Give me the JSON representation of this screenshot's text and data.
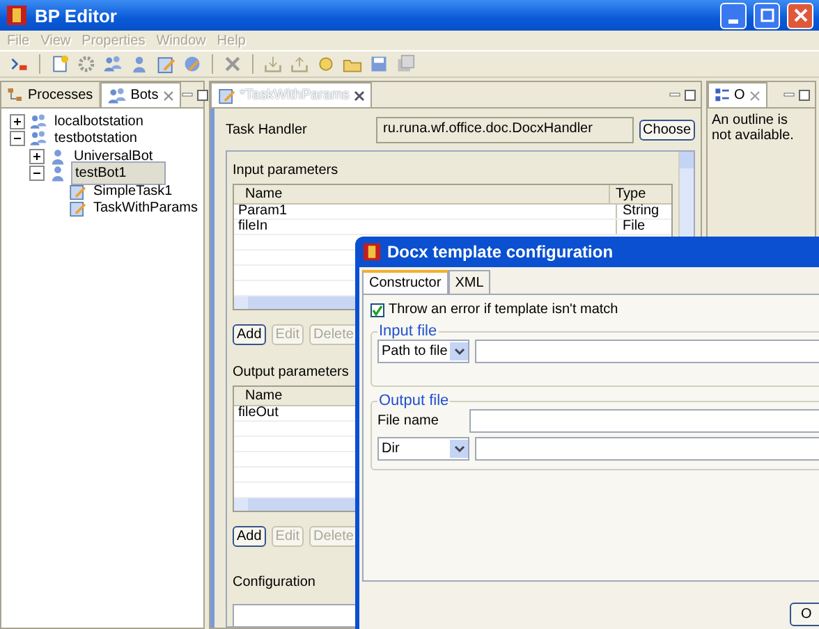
{
  "window": {
    "title": "BP Editor"
  },
  "menu": [
    {
      "label": "File",
      "disabled": true
    },
    {
      "label": "View",
      "disabled": true
    },
    {
      "label": "Properties",
      "disabled": true
    },
    {
      "label": "Window",
      "disabled": true
    },
    {
      "label": "Help",
      "disabled": true
    }
  ],
  "left_panel": {
    "tabs": [
      {
        "label": "Processes",
        "selected": false
      },
      {
        "label": "Bots",
        "selected": true
      }
    ],
    "tree": [
      {
        "label": "localbotstation",
        "kind": "station",
        "expanded": false,
        "selected": false
      },
      {
        "label": "testbotstation",
        "kind": "station",
        "expanded": true,
        "selected": false,
        "children": [
          {
            "label": "UniversalBot",
            "kind": "bot",
            "expanded": false,
            "selected": false
          },
          {
            "label": "testBot1",
            "kind": "bot",
            "expanded": true,
            "selected": true,
            "children": [
              {
                "label": "SimpleTask1",
                "kind": "task",
                "selected": false
              },
              {
                "label": "TaskWithParams",
                "kind": "task",
                "selected": false
              }
            ]
          }
        ]
      }
    ]
  },
  "editor": {
    "tab": "*TaskWithParams",
    "task_handler": {
      "label": "Task Handler",
      "value": "ru.runa.wf.office.doc.DocxHandler",
      "button": "Choose"
    },
    "input_parameters": {
      "title": "Input parameters",
      "columns": [
        "Name",
        "Type"
      ],
      "rows": [
        [
          "Param1",
          "String"
        ],
        [
          "fileIn",
          "File"
        ]
      ],
      "buttons": [
        {
          "label": "Add",
          "disabled": false
        },
        {
          "label": "Edit",
          "disabled": true
        },
        {
          "label": "Delete",
          "disabled": true
        }
      ]
    },
    "output_parameters": {
      "title": "Output parameters",
      "columns": [
        "Name"
      ],
      "rows": [
        [
          "fileOut"
        ]
      ],
      "buttons": [
        {
          "label": "Add",
          "disabled": false
        },
        {
          "label": "Edit",
          "disabled": true
        },
        {
          "label": "Delete",
          "disabled": true
        }
      ]
    },
    "configuration": "Configuration"
  },
  "outline": {
    "tab": "O",
    "message": "An outline is not available."
  },
  "dialog": {
    "title": "Docx template configuration",
    "tabs": [
      {
        "label": "Constructor",
        "selected": true
      },
      {
        "label": "XML",
        "selected": false
      }
    ],
    "throw_error": {
      "label": "Throw an error if template isn't match",
      "checked": true
    },
    "input_file": {
      "title": "Input file",
      "source": "Path to file"
    },
    "output_file": {
      "title": "Output file",
      "file_name_label": "File name",
      "source": "Dir"
    },
    "buttons": [
      "O"
    ]
  }
}
